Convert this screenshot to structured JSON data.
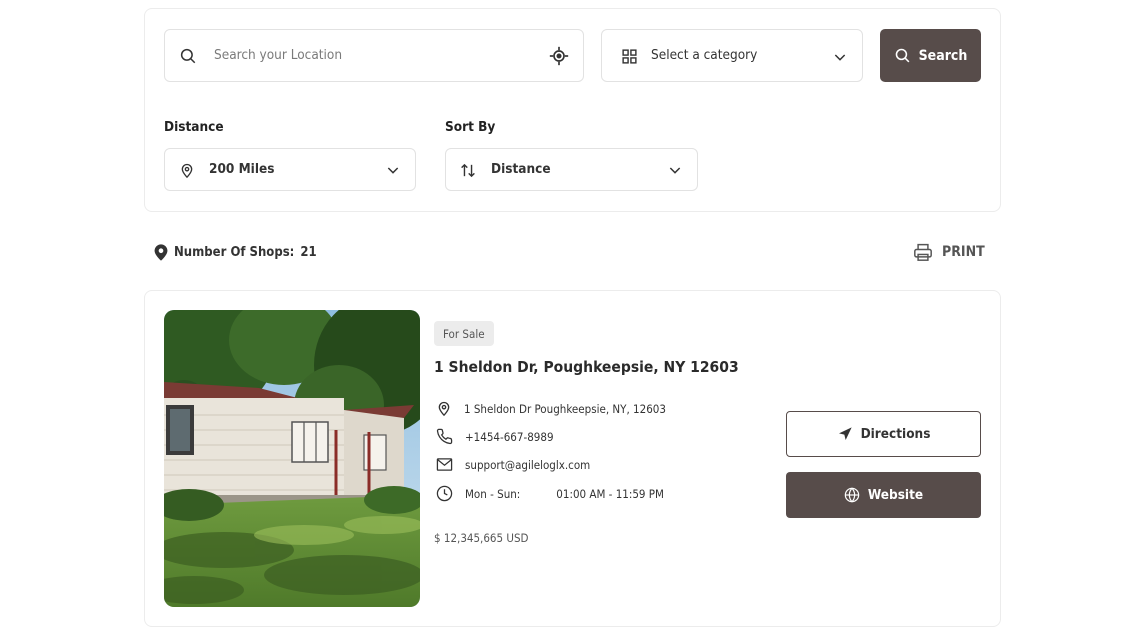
{
  "search": {
    "location_placeholder": "Search your Location",
    "category_placeholder": "Select a category",
    "search_label": "Search"
  },
  "filters": {
    "distance_label": "Distance",
    "distance_value": "200 Miles",
    "sort_label": "Sort By",
    "sort_value": "Distance"
  },
  "results": {
    "count_label": "Number Of Shops:",
    "count_value": "21",
    "print_label": "PRINT"
  },
  "listing": {
    "badge": "For Sale",
    "title": "1 Sheldon Dr, Poughkeepsie, NY 12603",
    "address": "1 Sheldon Dr Poughkeepsie, NY, 12603",
    "phone": "+1454-667-8989",
    "email": "support@agileloglx.com",
    "hours_days": "Mon - Sun:",
    "hours_time": "01:00 AM - 11:59 PM",
    "price": "$ 12,345,665 USD",
    "directions_label": "Directions",
    "website_label": "Website"
  },
  "colors": {
    "brand": "#574c4a",
    "border": "#e2e2e2"
  },
  "icons": {
    "search": "search-icon",
    "locate": "crosshair-icon",
    "category": "grid-icon",
    "chevron": "chevron-down-icon",
    "pin": "map-pin-icon",
    "sort": "sort-icon",
    "printer": "printer-icon",
    "phone": "phone-icon",
    "mail": "mail-icon",
    "clock": "clock-icon",
    "navigation": "navigation-arrow-icon",
    "globe": "globe-icon"
  }
}
